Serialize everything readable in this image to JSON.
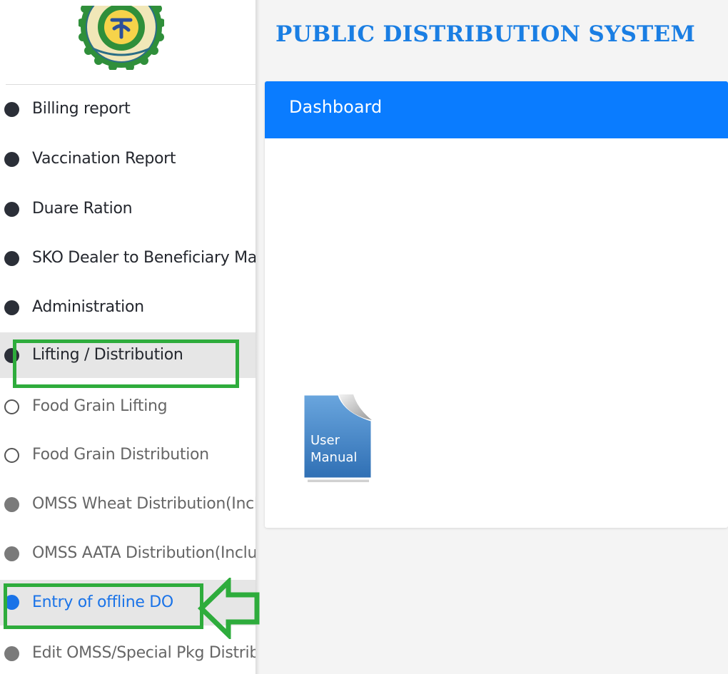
{
  "app": {
    "title": "PUBLIC DISTRIBUTION SYSTEM",
    "logo_icon": "west-bengal-govt-emblem-icon",
    "colors": {
      "accent": "#0a7cff",
      "title": "#1a7ee3",
      "highlight": "#2eac3c",
      "active_item": "#1a73e8"
    }
  },
  "sidebar": {
    "items": [
      {
        "label": "Billing report",
        "bullet": "filled-dark"
      },
      {
        "label": "Vaccination Report",
        "bullet": "filled-dark"
      },
      {
        "label": "Duare Ration",
        "bullet": "filled-dark"
      },
      {
        "label": "SKO Dealer to Beneficiary Map",
        "bullet": "filled-dark"
      },
      {
        "label": "Administration",
        "bullet": "filled-dark"
      },
      {
        "label": "Lifting / Distribution",
        "bullet": "filled-dark",
        "expanded": true
      },
      {
        "label": "Food Grain Lifting",
        "bullet": "ring"
      },
      {
        "label": "Food Grain Distribution",
        "bullet": "ring"
      },
      {
        "label": "OMSS Wheat Distribution(Incl",
        "bullet": "filled-grey"
      },
      {
        "label": "OMSS AATA Distribution(Inclu",
        "bullet": "filled-grey"
      },
      {
        "label": "Entry of offline DO",
        "bullet": "filled-blue",
        "active": true
      },
      {
        "label": "Edit OMSS/Special Pkg Distrib",
        "bullet": "filled-grey"
      }
    ]
  },
  "main": {
    "card": {
      "header": "Dashboard",
      "user_manual": {
        "line1": "User",
        "line2": "Manual",
        "icon": "user-manual-document-icon"
      }
    }
  }
}
